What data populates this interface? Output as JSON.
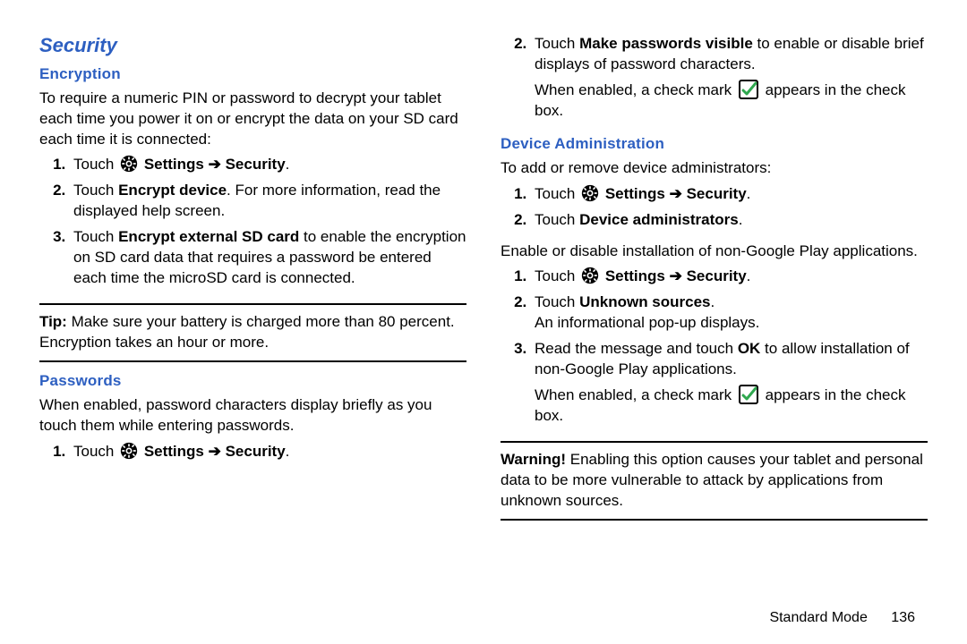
{
  "left": {
    "title": "Security",
    "encryption": {
      "heading": "Encryption",
      "intro": "To require a numeric PIN or password to decrypt your tablet each time you power it on or encrypt the data on your SD card each time it is connected:",
      "step1_a": "Touch ",
      "step1_b": " Settings ➔ Security",
      "step1_c": ".",
      "step2_a": "Touch ",
      "step2_b": "Encrypt device",
      "step2_c": ". For more information, read the displayed help screen.",
      "step3_a": "Touch ",
      "step3_b": "Encrypt external SD card",
      "step3_c": " to enable the encryption on SD card data that requires a password be entered each time the microSD card is connected.",
      "tip_label": "Tip:",
      "tip_text": " Make sure your battery is charged more than 80 percent. Encryption takes an hour or more."
    },
    "passwords": {
      "heading": "Passwords",
      "intro": "When enabled, password characters display briefly as you touch them while entering passwords.",
      "step1_a": "Touch ",
      "step1_b": " Settings ➔ Security",
      "step1_c": "."
    }
  },
  "right": {
    "pwstep2_a": "Touch ",
    "pwstep2_b": "Make passwords visible",
    "pwstep2_c": " to enable or disable brief displays of password characters.",
    "pwcheck_a": "When enabled, a check mark ",
    "pwcheck_b": " appears in the check box.",
    "device_admin": {
      "heading": "Device Administration",
      "intro": "To add or remove device administrators:",
      "da_step1_a": "Touch ",
      "da_step1_b": " Settings ➔ Security",
      "da_step1_c": ".",
      "da_step2_a": "Touch ",
      "da_step2_b": "Device administrators",
      "da_step2_c": ".",
      "non_gp_intro": "Enable or disable installation of non-Google Play applications.",
      "us_step1_a": "Touch ",
      "us_step1_b": " Settings ➔ Security",
      "us_step1_c": ".",
      "us_step2_a": "Touch ",
      "us_step2_b": "Unknown sources",
      "us_step2_c": ".",
      "us_step2_info": "An informational pop-up displays.",
      "us_step3_a": "Read the message and touch ",
      "us_step3_b": "OK",
      "us_step3_c": " to allow installation of non-Google Play applications.",
      "us_check_a": "When enabled, a check mark ",
      "us_check_b": " appears in the check box.",
      "warn_label": "Warning!",
      "warn_text": " Enabling this option causes your tablet and personal data to be more vulnerable to attack by applications from unknown sources."
    }
  },
  "footer": {
    "mode": "Standard Mode",
    "page": "136"
  }
}
